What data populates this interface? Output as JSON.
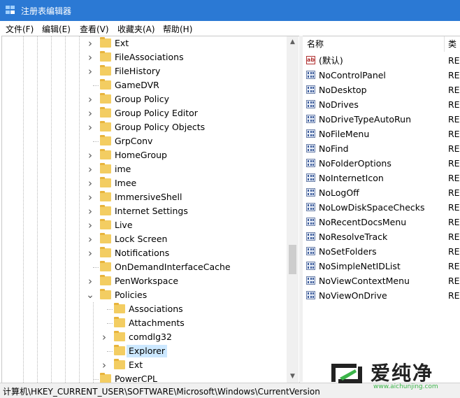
{
  "window": {
    "title": "注册表编辑器",
    "accent": "#2b79d4"
  },
  "menu": [
    {
      "label": "文件(F)"
    },
    {
      "label": "编辑(E)"
    },
    {
      "label": "查看(V)"
    },
    {
      "label": "收藏夹(A)"
    },
    {
      "label": "帮助(H)"
    }
  ],
  "tree": {
    "items": [
      {
        "label": "Ext",
        "expander": ">"
      },
      {
        "label": "FileAssociations",
        "expander": ">"
      },
      {
        "label": "FileHistory",
        "expander": ">"
      },
      {
        "label": "GameDVR",
        "expander": ""
      },
      {
        "label": "Group Policy",
        "expander": ">"
      },
      {
        "label": "Group Policy Editor",
        "expander": ">"
      },
      {
        "label": "Group Policy Objects",
        "expander": ">"
      },
      {
        "label": "GrpConv",
        "expander": ""
      },
      {
        "label": "HomeGroup",
        "expander": ">"
      },
      {
        "label": "ime",
        "expander": ">"
      },
      {
        "label": "Imee",
        "expander": ">"
      },
      {
        "label": "ImmersiveShell",
        "expander": ">"
      },
      {
        "label": "Internet Settings",
        "expander": ">"
      },
      {
        "label": "Live",
        "expander": ">"
      },
      {
        "label": "Lock Screen",
        "expander": ">"
      },
      {
        "label": "Notifications",
        "expander": ">"
      },
      {
        "label": "OnDemandInterfaceCache",
        "expander": ""
      },
      {
        "label": "PenWorkspace",
        "expander": ">"
      },
      {
        "label": "Policies",
        "expander": "v"
      },
      {
        "label": "Associations",
        "expander": "",
        "child": true
      },
      {
        "label": "Attachments",
        "expander": "",
        "child": true
      },
      {
        "label": "comdlg32",
        "expander": ">",
        "child": true
      },
      {
        "label": "Explorer",
        "expander": "",
        "child": true,
        "selected": true
      },
      {
        "label": "Ext",
        "expander": ">",
        "child": true
      },
      {
        "label": "PowerCPL",
        "expander": ""
      }
    ]
  },
  "values": {
    "headers": {
      "name": "名称",
      "type": "类"
    },
    "items": [
      {
        "name": "(默认)",
        "type": "RE",
        "icon": "string-value-icon"
      },
      {
        "name": "NoControlPanel",
        "type": "RE",
        "icon": "binary-value-icon"
      },
      {
        "name": "NoDesktop",
        "type": "RE",
        "icon": "binary-value-icon"
      },
      {
        "name": "NoDrives",
        "type": "RE",
        "icon": "binary-value-icon"
      },
      {
        "name": "NoDriveTypeAutoRun",
        "type": "RE",
        "icon": "binary-value-icon"
      },
      {
        "name": "NoFileMenu",
        "type": "RE",
        "icon": "binary-value-icon"
      },
      {
        "name": "NoFind",
        "type": "RE",
        "icon": "binary-value-icon"
      },
      {
        "name": "NoFolderOptions",
        "type": "RE",
        "icon": "binary-value-icon"
      },
      {
        "name": "NoInternetIcon",
        "type": "RE",
        "icon": "binary-value-icon"
      },
      {
        "name": "NoLogOff",
        "type": "RE",
        "icon": "binary-value-icon"
      },
      {
        "name": "NoLowDiskSpaceChecks",
        "type": "RE",
        "icon": "binary-value-icon"
      },
      {
        "name": "NoRecentDocsMenu",
        "type": "RE",
        "icon": "binary-value-icon"
      },
      {
        "name": "NoResolveTrack",
        "type": "RE",
        "icon": "binary-value-icon"
      },
      {
        "name": "NoSetFolders",
        "type": "RE",
        "icon": "binary-value-icon"
      },
      {
        "name": "NoSimpleNetIDList",
        "type": "RE",
        "icon": "binary-value-icon"
      },
      {
        "name": "NoViewContextMenu",
        "type": "RE",
        "icon": "binary-value-icon"
      },
      {
        "name": "NoViewOnDrive",
        "type": "RE",
        "icon": "binary-value-icon"
      }
    ]
  },
  "status": {
    "path": "计算机\\HKEY_CURRENT_USER\\SOFTWARE\\Microsoft\\Windows\\CurrentVersion"
  },
  "watermark": {
    "text": "爱纯净",
    "url": "www.aichunjing.com",
    "color": "#3cb54a"
  }
}
